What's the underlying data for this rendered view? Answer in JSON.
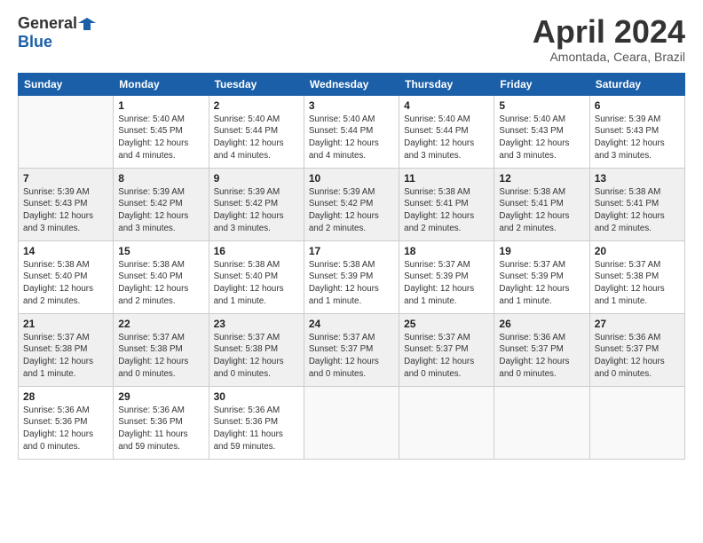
{
  "logo": {
    "general": "General",
    "blue": "Blue"
  },
  "header": {
    "title": "April 2024",
    "subtitle": "Amontada, Ceara, Brazil"
  },
  "weekdays": [
    "Sunday",
    "Monday",
    "Tuesday",
    "Wednesday",
    "Thursday",
    "Friday",
    "Saturday"
  ],
  "weeks": [
    [
      {
        "day": "",
        "info": ""
      },
      {
        "day": "1",
        "info": "Sunrise: 5:40 AM\nSunset: 5:45 PM\nDaylight: 12 hours\nand 4 minutes."
      },
      {
        "day": "2",
        "info": "Sunrise: 5:40 AM\nSunset: 5:44 PM\nDaylight: 12 hours\nand 4 minutes."
      },
      {
        "day": "3",
        "info": "Sunrise: 5:40 AM\nSunset: 5:44 PM\nDaylight: 12 hours\nand 4 minutes."
      },
      {
        "day": "4",
        "info": "Sunrise: 5:40 AM\nSunset: 5:44 PM\nDaylight: 12 hours\nand 3 minutes."
      },
      {
        "day": "5",
        "info": "Sunrise: 5:40 AM\nSunset: 5:43 PM\nDaylight: 12 hours\nand 3 minutes."
      },
      {
        "day": "6",
        "info": "Sunrise: 5:39 AM\nSunset: 5:43 PM\nDaylight: 12 hours\nand 3 minutes."
      }
    ],
    [
      {
        "day": "7",
        "info": "Sunrise: 5:39 AM\nSunset: 5:43 PM\nDaylight: 12 hours\nand 3 minutes."
      },
      {
        "day": "8",
        "info": "Sunrise: 5:39 AM\nSunset: 5:42 PM\nDaylight: 12 hours\nand 3 minutes."
      },
      {
        "day": "9",
        "info": "Sunrise: 5:39 AM\nSunset: 5:42 PM\nDaylight: 12 hours\nand 3 minutes."
      },
      {
        "day": "10",
        "info": "Sunrise: 5:39 AM\nSunset: 5:42 PM\nDaylight: 12 hours\nand 2 minutes."
      },
      {
        "day": "11",
        "info": "Sunrise: 5:38 AM\nSunset: 5:41 PM\nDaylight: 12 hours\nand 2 minutes."
      },
      {
        "day": "12",
        "info": "Sunrise: 5:38 AM\nSunset: 5:41 PM\nDaylight: 12 hours\nand 2 minutes."
      },
      {
        "day": "13",
        "info": "Sunrise: 5:38 AM\nSunset: 5:41 PM\nDaylight: 12 hours\nand 2 minutes."
      }
    ],
    [
      {
        "day": "14",
        "info": "Sunrise: 5:38 AM\nSunset: 5:40 PM\nDaylight: 12 hours\nand 2 minutes."
      },
      {
        "day": "15",
        "info": "Sunrise: 5:38 AM\nSunset: 5:40 PM\nDaylight: 12 hours\nand 2 minutes."
      },
      {
        "day": "16",
        "info": "Sunrise: 5:38 AM\nSunset: 5:40 PM\nDaylight: 12 hours\nand 1 minute."
      },
      {
        "day": "17",
        "info": "Sunrise: 5:38 AM\nSunset: 5:39 PM\nDaylight: 12 hours\nand 1 minute."
      },
      {
        "day": "18",
        "info": "Sunrise: 5:37 AM\nSunset: 5:39 PM\nDaylight: 12 hours\nand 1 minute."
      },
      {
        "day": "19",
        "info": "Sunrise: 5:37 AM\nSunset: 5:39 PM\nDaylight: 12 hours\nand 1 minute."
      },
      {
        "day": "20",
        "info": "Sunrise: 5:37 AM\nSunset: 5:38 PM\nDaylight: 12 hours\nand 1 minute."
      }
    ],
    [
      {
        "day": "21",
        "info": "Sunrise: 5:37 AM\nSunset: 5:38 PM\nDaylight: 12 hours\nand 1 minute."
      },
      {
        "day": "22",
        "info": "Sunrise: 5:37 AM\nSunset: 5:38 PM\nDaylight: 12 hours\nand 0 minutes."
      },
      {
        "day": "23",
        "info": "Sunrise: 5:37 AM\nSunset: 5:38 PM\nDaylight: 12 hours\nand 0 minutes."
      },
      {
        "day": "24",
        "info": "Sunrise: 5:37 AM\nSunset: 5:37 PM\nDaylight: 12 hours\nand 0 minutes."
      },
      {
        "day": "25",
        "info": "Sunrise: 5:37 AM\nSunset: 5:37 PM\nDaylight: 12 hours\nand 0 minutes."
      },
      {
        "day": "26",
        "info": "Sunrise: 5:36 AM\nSunset: 5:37 PM\nDaylight: 12 hours\nand 0 minutes."
      },
      {
        "day": "27",
        "info": "Sunrise: 5:36 AM\nSunset: 5:37 PM\nDaylight: 12 hours\nand 0 minutes."
      }
    ],
    [
      {
        "day": "28",
        "info": "Sunrise: 5:36 AM\nSunset: 5:36 PM\nDaylight: 12 hours\nand 0 minutes."
      },
      {
        "day": "29",
        "info": "Sunrise: 5:36 AM\nSunset: 5:36 PM\nDaylight: 11 hours\nand 59 minutes."
      },
      {
        "day": "30",
        "info": "Sunrise: 5:36 AM\nSunset: 5:36 PM\nDaylight: 11 hours\nand 59 minutes."
      },
      {
        "day": "",
        "info": ""
      },
      {
        "day": "",
        "info": ""
      },
      {
        "day": "",
        "info": ""
      },
      {
        "day": "",
        "info": ""
      }
    ]
  ]
}
